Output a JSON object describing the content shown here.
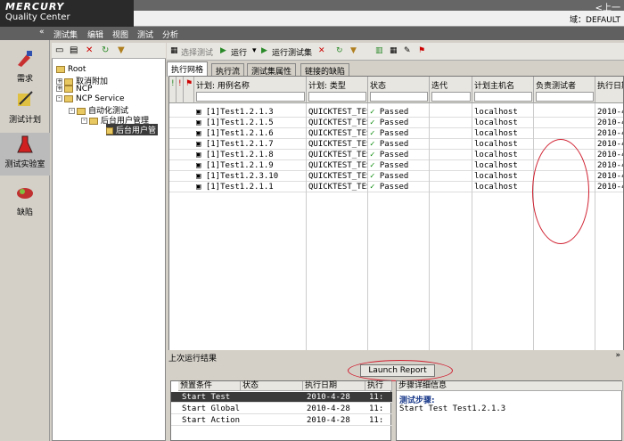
{
  "app": {
    "brand": "MERCURY",
    "name": "Quality Center",
    "top_right": "<上一",
    "domain_label": "域：DEFAULT"
  },
  "menu": {
    "collapse": "«",
    "items": [
      "测试集",
      "编辑",
      "视图",
      "测试",
      "分析"
    ]
  },
  "sidebar": {
    "items": [
      {
        "label": "需求",
        "icon": "requirements-icon"
      },
      {
        "label": "测试计划",
        "icon": "test-plan-icon"
      },
      {
        "label": "测试实验室",
        "icon": "test-lab-icon"
      },
      {
        "label": "缺陷",
        "icon": "defects-icon"
      }
    ]
  },
  "tree": {
    "nodes": [
      "Root",
      "取消附加",
      "NCP",
      "NCP Service",
      "自动化测试",
      "后台用户管理",
      "后台用户管"
    ]
  },
  "toolbar": {
    "select_tests": "选择测试",
    "run": "运行",
    "run_test_set": "运行测试集"
  },
  "tabs": [
    "执行网格",
    "执行流",
    "测试集属性",
    "链接的缺陷"
  ],
  "grid": {
    "columns": [
      "计划: 用例名称",
      "计划: 类型",
      "状态",
      "迭代",
      "计划主机名",
      "负责测试者",
      "执行日期"
    ],
    "rows": [
      {
        "name": "[1]Test1.2.1.3",
        "type": "QUICKTEST_TEST",
        "status": "Passed",
        "host": "localhost",
        "date": "2010-4-"
      },
      {
        "name": "[1]Test1.2.1.5",
        "type": "QUICKTEST_TEST",
        "status": "Passed",
        "host": "localhost",
        "date": "2010-4-"
      },
      {
        "name": "[1]Test1.2.1.6",
        "type": "QUICKTEST_TEST",
        "status": "Passed",
        "host": "localhost",
        "date": "2010-4-"
      },
      {
        "name": "[1]Test1.2.1.7",
        "type": "QUICKTEST_TEST",
        "status": "Passed",
        "host": "localhost",
        "date": "2010-4-"
      },
      {
        "name": "[1]Test1.2.1.8",
        "type": "QUICKTEST_TEST",
        "status": "Passed",
        "host": "localhost",
        "date": "2010-4-"
      },
      {
        "name": "[1]Test1.2.1.9",
        "type": "QUICKTEST_TEST",
        "status": "Passed",
        "host": "localhost",
        "date": "2010-4-"
      },
      {
        "name": "[1]Test1.2.3.10",
        "type": "QUICKTEST_TEST",
        "status": "Passed",
        "host": "localhost",
        "date": "2010-4-"
      },
      {
        "name": "[1]Test1.2.1.1",
        "type": "QUICKTEST_TEST",
        "status": "Passed",
        "host": "localhost",
        "date": "2010-4-"
      }
    ]
  },
  "last_run": {
    "title": "上次运行结果",
    "launch_report": "Launch Report",
    "columns": [
      "预置条件",
      "状态",
      "执行日期",
      "执行"
    ],
    "rows": [
      {
        "name": "Start Test",
        "date": "2010-4-28",
        "time": "11:"
      },
      {
        "name": "Start Global I",
        "date": "2010-4-28",
        "time": "11:"
      },
      {
        "name": "Start Action",
        "date": "2010-4-28",
        "time": "11:"
      }
    ],
    "detail_header": "步骤详细信息",
    "detail_label": "测试步骤:",
    "detail_text": "Start Test Test1.2.1.3"
  }
}
